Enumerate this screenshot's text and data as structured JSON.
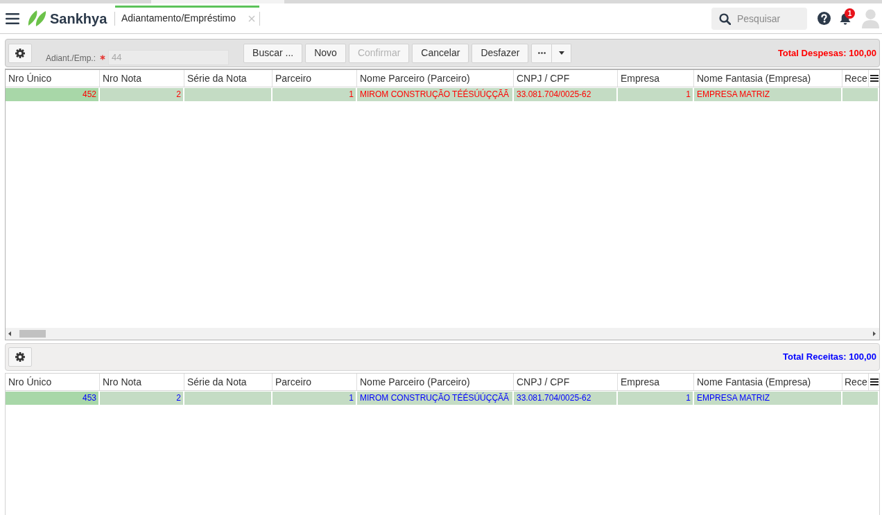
{
  "brand": {
    "name": "Sankhya"
  },
  "tabs": [
    {
      "label": "Adiantamento/Empréstimo",
      "selected": true
    }
  ],
  "search": {
    "placeholder": "Pesquisar"
  },
  "notifications": {
    "count": "1"
  },
  "panels": [
    {
      "selected": true,
      "toolbar": {
        "field": {
          "label": "Adiant./Emp.:",
          "required": true,
          "value": "44",
          "disabled": true
        },
        "buttons": [
          {
            "label": "Buscar ...",
            "disabled": false
          },
          {
            "label": "Novo",
            "disabled": false
          },
          {
            "label": "Confirmar",
            "disabled": true
          },
          {
            "label": "Cancelar",
            "disabled": false
          },
          {
            "label": "Desfazer",
            "disabled": false
          }
        ]
      },
      "total": "Total Despesas: 100,00",
      "color": "#ff0000",
      "scrollbar": true,
      "table": {
        "columns": [
          "Nro Único",
          "Nro Nota",
          "Série da Nota",
          "Parceiro",
          "Nome Parceiro (Parceiro)",
          "CNPJ / CPF",
          "Empresa",
          "Nome Fantasia (Empresa)",
          "Rece"
        ],
        "rows": [
          {
            "selected": true,
            "cells": [
              {
                "kind": "number",
                "text": "452",
                "focused": true
              },
              {
                "kind": "number",
                "text": "2",
                "focused": false
              },
              {
                "kind": "blank",
                "focused": false
              },
              {
                "kind": "number",
                "text": "1",
                "focused": false
              },
              {
                "kind": "text",
                "text": "MIROM CONSTRUÇÃO TÉÉSÚÚÇÇÃÃ",
                "focused": false
              },
              {
                "kind": "text",
                "text": "33.081.704/0025-62",
                "focused": false
              },
              {
                "kind": "number",
                "text": "1",
                "focused": false
              },
              {
                "kind": "text",
                "text": "EMPRESA MATRIZ",
                "focused": false
              },
              {
                "kind": "blank",
                "focused": false
              }
            ]
          }
        ]
      }
    },
    {
      "selected": false,
      "total": "Total Receitas: 100,00",
      "color": "#0000ff",
      "scrollbar": false,
      "table": {
        "columns": [
          "Nro Único",
          "Nro Nota",
          "Série da Nota",
          "Parceiro",
          "Nome Parceiro (Parceiro)",
          "CNPJ / CPF",
          "Empresa",
          "Nome Fantasia (Empresa)",
          "Rece"
        ],
        "rows": [
          {
            "selected": true,
            "cells": [
              {
                "kind": "number",
                "text": "453",
                "focused": true
              },
              {
                "kind": "number",
                "text": "2",
                "focused": false
              },
              {
                "kind": "blank",
                "focused": false
              },
              {
                "kind": "number",
                "text": "1",
                "focused": false
              },
              {
                "kind": "text",
                "text": "MIROM CONSTRUÇÃO TÉÉSÚÚÇÇÃÃ",
                "focused": false
              },
              {
                "kind": "text",
                "text": "33.081.704/0025-62",
                "focused": false
              },
              {
                "kind": "number",
                "text": "1",
                "focused": false
              },
              {
                "kind": "text",
                "text": "EMPRESA MATRIZ",
                "focused": false
              },
              {
                "kind": "blank",
                "focused": false
              }
            ]
          }
        ]
      }
    }
  ]
}
